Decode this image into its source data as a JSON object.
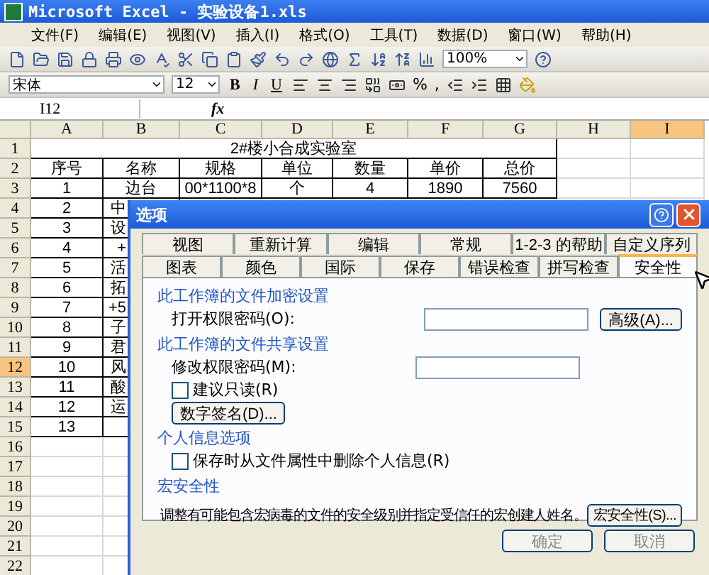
{
  "window": {
    "title": "Microsoft Excel - 实验设备1.xls"
  },
  "menu": [
    "文件(F)",
    "编辑(E)",
    "视图(V)",
    "插入(I)",
    "格式(O)",
    "工具(T)",
    "数据(D)",
    "窗口(W)",
    "帮助(H)"
  ],
  "standard_toolbar": {
    "zoom": "100%"
  },
  "formatting_toolbar": {
    "font": "宋体",
    "size": "12",
    "buttons": [
      {
        "label": "B",
        "kind": "bold"
      },
      {
        "label": "I",
        "kind": "italic"
      },
      {
        "label": "U",
        "kind": "underline"
      }
    ],
    "percent": "%",
    "comma": ","
  },
  "formula_bar": {
    "name_box": "I12",
    "fx": "fx"
  },
  "columns": [
    {
      "label": "A",
      "selected": false
    },
    {
      "label": "B",
      "selected": false
    },
    {
      "label": "C",
      "selected": false
    },
    {
      "label": "D",
      "selected": false
    },
    {
      "label": "E",
      "selected": false
    },
    {
      "label": "F",
      "selected": false
    },
    {
      "label": "G",
      "selected": false
    },
    {
      "label": "H",
      "selected": false
    },
    {
      "label": "I",
      "selected": true
    }
  ],
  "rows": [
    {
      "header": "1",
      "selected": false,
      "kind": "title",
      "cells": [
        "2#楼小合成实验室"
      ]
    },
    {
      "header": "2",
      "selected": false,
      "kind": "data",
      "cells": [
        "序号",
        "名称",
        "规格",
        "单位",
        "数量",
        "单价",
        "总价"
      ]
    },
    {
      "header": "3",
      "selected": false,
      "kind": "data",
      "cells": [
        "1",
        "边台",
        "00*1100*8",
        "个",
        "4",
        "1890",
        "7560"
      ]
    },
    {
      "header": "4",
      "selected": false,
      "kind": "data",
      "cells": [
        "2",
        "中"
      ]
    },
    {
      "header": "5",
      "selected": false,
      "kind": "data",
      "cells": [
        "3",
        "设"
      ]
    },
    {
      "header": "6",
      "selected": false,
      "kind": "data",
      "cells": [
        "4",
        "+"
      ]
    },
    {
      "header": "7",
      "selected": false,
      "kind": "data",
      "cells": [
        "5",
        "活"
      ]
    },
    {
      "header": "8",
      "selected": false,
      "kind": "data",
      "cells": [
        "6",
        "拓"
      ]
    },
    {
      "header": "9",
      "selected": false,
      "kind": "data",
      "cells": [
        "7",
        "+5"
      ]
    },
    {
      "header": "10",
      "selected": false,
      "kind": "data",
      "cells": [
        "8",
        "子"
      ]
    },
    {
      "header": "11",
      "selected": false,
      "kind": "data",
      "cells": [
        "9",
        "君"
      ]
    },
    {
      "header": "12",
      "selected": true,
      "kind": "data",
      "cells": [
        "10",
        "风"
      ]
    },
    {
      "header": "13",
      "selected": false,
      "kind": "data",
      "cells": [
        "11",
        "酸"
      ]
    },
    {
      "header": "14",
      "selected": false,
      "kind": "data",
      "cells": [
        "12",
        "运"
      ]
    },
    {
      "header": "15",
      "selected": false,
      "kind": "data",
      "cells": [
        "13",
        ""
      ]
    },
    {
      "header": "16",
      "selected": false,
      "kind": "empty",
      "cells": []
    },
    {
      "header": "17",
      "selected": false,
      "kind": "empty",
      "cells": []
    },
    {
      "header": "18",
      "selected": false,
      "kind": "empty",
      "cells": []
    },
    {
      "header": "19",
      "selected": false,
      "kind": "empty",
      "cells": []
    },
    {
      "header": "20",
      "selected": false,
      "kind": "empty",
      "cells": []
    },
    {
      "header": "21",
      "selected": false,
      "kind": "empty",
      "cells": []
    },
    {
      "header": "22",
      "selected": false,
      "kind": "empty",
      "cells": []
    }
  ],
  "dialog": {
    "title": "选项",
    "tab_rows": [
      [
        {
          "label": "视图",
          "selected": false
        },
        {
          "label": "重新计算",
          "selected": false
        },
        {
          "label": "编辑",
          "selected": false
        },
        {
          "label": "常规",
          "selected": false
        },
        {
          "label": "1-2-3 的帮助",
          "selected": false
        },
        {
          "label": "自定义序列",
          "selected": false
        }
      ],
      [
        {
          "label": "图表",
          "selected": false
        },
        {
          "label": "颜色",
          "selected": false
        },
        {
          "label": "国际",
          "selected": false
        },
        {
          "label": "保存",
          "selected": false
        },
        {
          "label": "错误检查",
          "selected": false
        },
        {
          "label": "拼写检查",
          "selected": false
        },
        {
          "label": "安全性",
          "selected": true
        }
      ]
    ],
    "sections": [
      {
        "heading": "此工作簿的文件加密设置",
        "items": [
          {
            "kind": "password",
            "label": "打开权限密码(O):",
            "button": "高级(A)..."
          }
        ]
      },
      {
        "heading": "此工作簿的文件共享设置",
        "items": [
          {
            "kind": "password",
            "label": "修改权限密码(M):"
          },
          {
            "kind": "checkbox",
            "label": "建议只读(R)",
            "checked": false
          },
          {
            "kind": "button",
            "label": "数字签名(D)..."
          }
        ]
      },
      {
        "heading": "个人信息选项",
        "items": [
          {
            "kind": "checkbox",
            "label": "保存时从文件属性中删除个人信息(R)",
            "checked": false
          }
        ]
      },
      {
        "heading": "宏安全性",
        "items": [
          {
            "kind": "text",
            "label": "调整有可能包含宏病毒的文件的安全级别并指定受信任的宏创建人姓名。",
            "button": "宏安全性(S)..."
          }
        ]
      }
    ],
    "buttons": [
      "确定",
      "取消"
    ]
  }
}
